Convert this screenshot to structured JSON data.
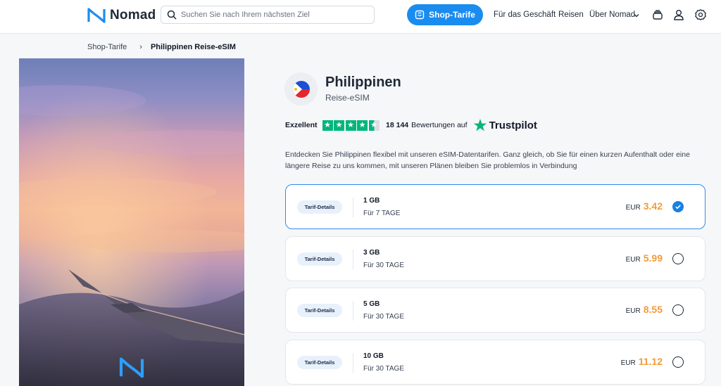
{
  "header": {
    "logo_text": "Nomad",
    "search_placeholder": "Suchen Sie nach Ihrem nächsten Ziel",
    "shop_button": "Shop-Tarife",
    "nav": {
      "business": "Für das Geschäft",
      "travel": "Reisen",
      "about": "Über Nomad"
    },
    "icons": [
      "chevron-down-icon",
      "stack-icon",
      "user-icon",
      "gear-icon"
    ]
  },
  "breadcrumb": {
    "root": "Shop-Tarife",
    "separator": "›",
    "current": "Philippinen Reise-eSIM"
  },
  "product": {
    "title": "Philippinen",
    "subtitle": "Reise-eSIM",
    "rating_label": "Exzellent",
    "stars": 4.5,
    "review_count": "18 144",
    "review_text": "Bewertungen auf",
    "trustpilot": "Trustpilot",
    "description": "Entdecken Sie Philippinen flexibel mit unseren eSIM-Datentarifen. Ganz gleich, ob Sie für einen kurzen Aufenthalt oder eine längere Reise zu uns kommen, mit unseren Plänen bleiben Sie problemlos in Verbindung"
  },
  "plans": [
    {
      "pill": "Tarif-Details",
      "data": "1 GB",
      "duration": "Für 7 TAGE",
      "currency": "EUR",
      "price": "3.42",
      "selected": true
    },
    {
      "pill": "Tarif-Details",
      "data": "3 GB",
      "duration": "Für 30 TAGE",
      "currency": "EUR",
      "price": "5.99",
      "selected": false
    },
    {
      "pill": "Tarif-Details",
      "data": "5 GB",
      "duration": "Für 30 TAGE",
      "currency": "EUR",
      "price": "8.55",
      "selected": false
    },
    {
      "pill": "Tarif-Details",
      "data": "10 GB",
      "duration": "Für 30 TAGE",
      "currency": "EUR",
      "price": "11.12",
      "selected": false
    }
  ],
  "colors": {
    "accent": "#1a8cf0",
    "price": "#f39b3a",
    "trustpilot_green": "#00b67a"
  }
}
